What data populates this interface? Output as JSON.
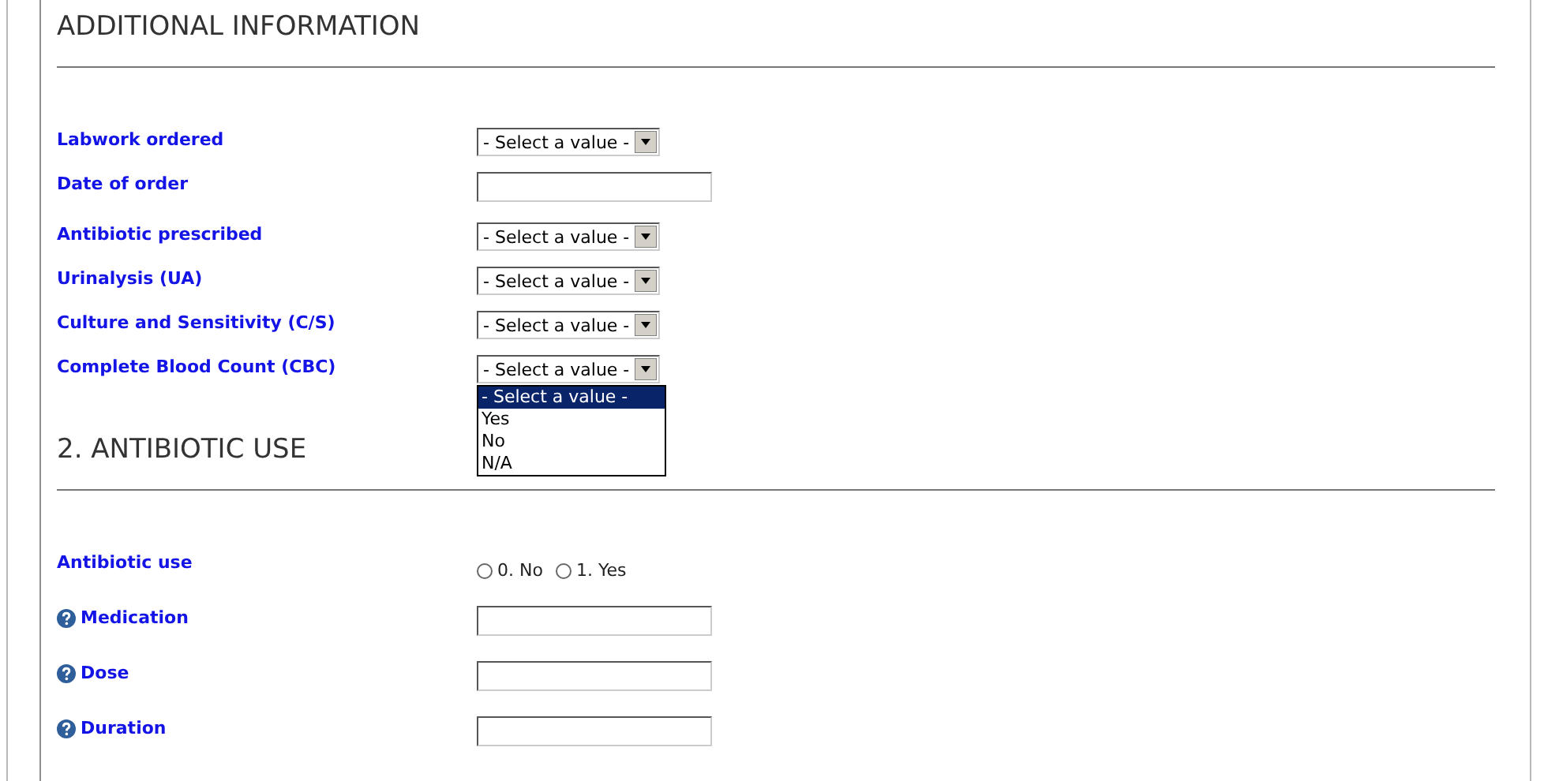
{
  "sections": [
    {
      "title": "ADDITIONAL INFORMATION",
      "fields": [
        {
          "kind": "select",
          "label": "Labwork ordered",
          "value": "- Select a value -"
        },
        {
          "kind": "text",
          "label": "Date of order",
          "help": false
        },
        {
          "kind": "select",
          "label": "Antibiotic prescribed",
          "value": "- Select a value -"
        },
        {
          "kind": "select",
          "label": "Urinalysis (UA)",
          "value": "- Select a value -"
        },
        {
          "kind": "select",
          "label": "Culture and Sensitivity (C/S)",
          "value": "- Select a value -"
        },
        {
          "kind": "select",
          "label": "Complete Blood Count (CBC)",
          "value": "- Select a value -",
          "open": true,
          "options": [
            {
              "label": "- Select a value -",
              "selected": true
            },
            {
              "label": "Yes",
              "selected": false
            },
            {
              "label": "No",
              "selected": false
            },
            {
              "label": "N/A",
              "selected": false
            }
          ]
        }
      ]
    },
    {
      "title": "2. ANTIBIOTIC USE",
      "fields": [
        {
          "kind": "radio",
          "label": "Antibiotic use",
          "options": [
            {
              "label": "0. No",
              "checked": false
            },
            {
              "label": "1. Yes",
              "checked": false
            }
          ]
        },
        {
          "kind": "text",
          "label": "Medication",
          "help": true
        },
        {
          "kind": "text",
          "label": "Dose",
          "help": true
        },
        {
          "kind": "text",
          "label": "Duration",
          "help": true
        }
      ]
    }
  ]
}
